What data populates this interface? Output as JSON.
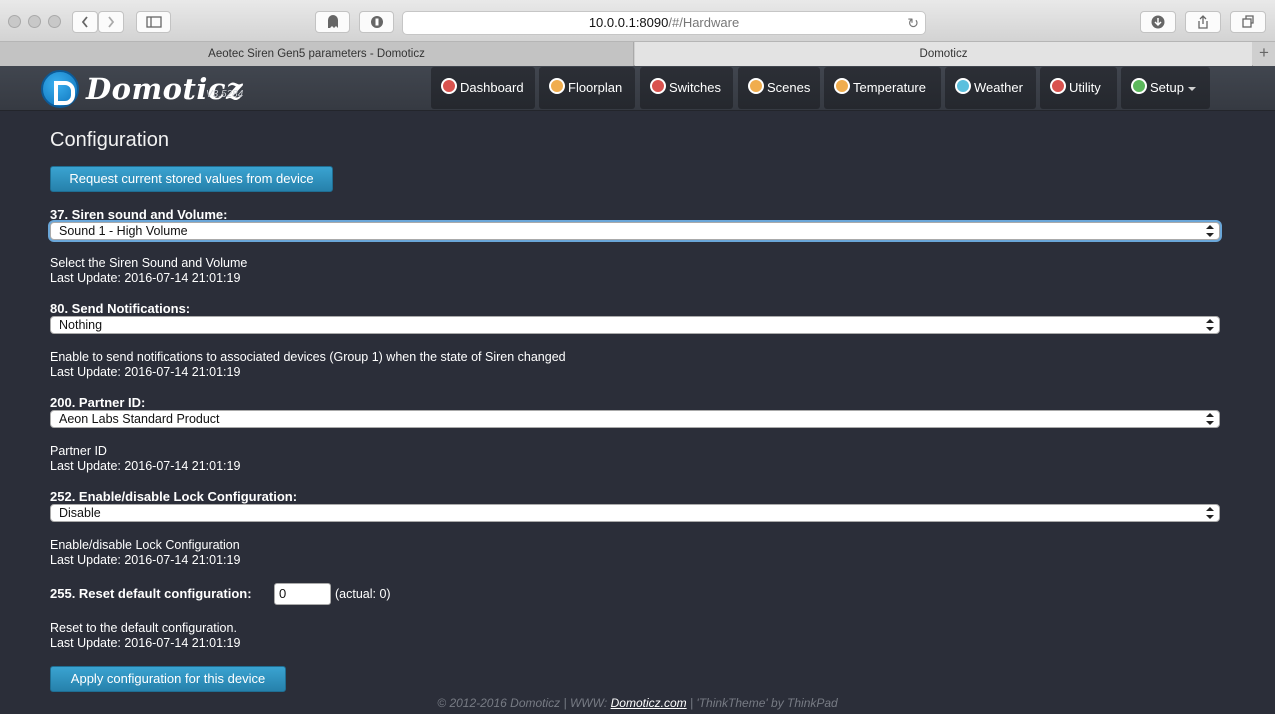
{
  "browser": {
    "url_host": "10.0.0.1:8090",
    "url_path": "/#/Hardware",
    "tabs": [
      {
        "label": "Aeotec Siren Gen5 parameters - Domoticz"
      },
      {
        "label": "Domoticz"
      }
    ]
  },
  "app": {
    "brand": "Domoticz",
    "version": "V3.5284",
    "nav": [
      {
        "label": "Dashboard",
        "icon": "dashboard-icon",
        "color": "#d9534f"
      },
      {
        "label": "Floorplan",
        "icon": "floorplan-icon",
        "color": "#f0ad4e"
      },
      {
        "label": "Switches",
        "icon": "switches-icon",
        "color": "#d9534f"
      },
      {
        "label": "Scenes",
        "icon": "scenes-icon",
        "color": "#f0ad4e"
      },
      {
        "label": "Temperature",
        "icon": "temperature-icon",
        "color": "#f0ad4e"
      },
      {
        "label": "Weather",
        "icon": "weather-icon",
        "color": "#5bc0de"
      },
      {
        "label": "Utility",
        "icon": "utility-icon",
        "color": "#d9534f"
      },
      {
        "label": "Setup",
        "icon": "setup-icon",
        "color": "#5cb85c"
      }
    ]
  },
  "config": {
    "title": "Configuration",
    "request_button": "Request current stored values from device",
    "apply_button": "Apply configuration for this device",
    "params": [
      {
        "label": "37. Siren sound and Volume:",
        "value": "Sound 1 - High Volume",
        "description": "Select the Siren Sound and Volume",
        "last_update": "Last Update: 2016-07-14 21:01:19"
      },
      {
        "label": "80. Send Notifications:",
        "value": "Nothing",
        "description": "Enable to send notifications to associated devices (Group 1) when the state of Siren changed",
        "last_update": "Last Update: 2016-07-14 21:01:19"
      },
      {
        "label": "200. Partner ID:",
        "value": "Aeon Labs Standard Product",
        "description": "Partner ID",
        "last_update": "Last Update: 2016-07-14 21:01:19"
      },
      {
        "label": "252. Enable/disable Lock Configuration:",
        "value": "Disable",
        "description": "Enable/disable Lock Configuration",
        "last_update": "Last Update: 2016-07-14 21:01:19"
      },
      {
        "label": "255. Reset default configuration:",
        "value": "0",
        "actual": "(actual: 0)",
        "description": "Reset to the default configuration.",
        "last_update": "Last Update: 2016-07-14 21:01:19"
      }
    ]
  },
  "footer": {
    "prefix": "© 2012-2016 Domoticz | WWW: ",
    "link": "Domoticz.com",
    "suffix": " | 'ThinkTheme' by ThinkPad"
  }
}
